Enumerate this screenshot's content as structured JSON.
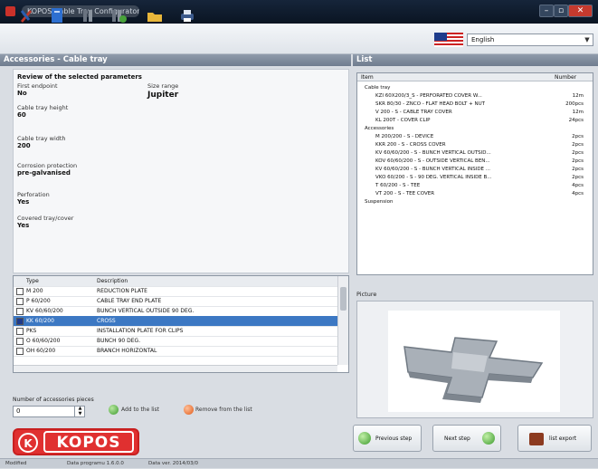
{
  "window": {
    "title": "KOPOS Cable Tray Configurator"
  },
  "toolbar": {
    "icons": [
      "tools-icon",
      "document-icon",
      "book-icon",
      "book-add-icon",
      "folder-icon",
      "print-icon"
    ],
    "language": "English"
  },
  "left_header": "Accessories - Cable tray",
  "right_header": "List",
  "params": {
    "section_title": "Review of the selected parameters",
    "first_label": "First endpoint",
    "first_value": "No",
    "range_label": "Size range",
    "range_value": "Jupiter",
    "height_label": "Cable tray height",
    "height_value": "60",
    "width_label": "Cable tray width",
    "width_value": "200",
    "corrosion_label": "Corrosion protection",
    "corrosion_value": "pre-galvanised",
    "perforation_label": "Perforation",
    "perforation_value": "Yes",
    "covered_label": "Covered tray/cover",
    "covered_value": "Yes"
  },
  "table": {
    "headers": [
      "Type",
      "Description"
    ],
    "rows": [
      {
        "type": "M 200",
        "desc": "REDUCTION PLATE",
        "selected": false
      },
      {
        "type": "P 60/200",
        "desc": "CABLE TRAY END PLATE",
        "selected": false
      },
      {
        "type": "KV 60/60/200",
        "desc": "BUNCH VERTICAL OUTSIDE 90 DEG.",
        "selected": false
      },
      {
        "type": "KK 60/200",
        "desc": "CROSS",
        "selected": true
      },
      {
        "type": "PKS",
        "desc": "INSTALLATION PLATE FOR CLIPS",
        "selected": false
      },
      {
        "type": "O 60/60/200",
        "desc": "BUNCH 90 DEG.",
        "selected": false
      },
      {
        "type": "OH 60/200",
        "desc": "BRANCH HORIZONTAL",
        "selected": false
      }
    ]
  },
  "qty": {
    "label": "Number of accessories pieces",
    "value": "0"
  },
  "buttons": {
    "add": "Add to the list",
    "remove": "Remove from the list",
    "previous": "Previous step",
    "next": "Next step",
    "export": "list export"
  },
  "logo": {
    "text": "KOPOS",
    "glyph": "K"
  },
  "list": {
    "headers": [
      "Item",
      "Number"
    ],
    "items": [
      {
        "text": "Cable tray",
        "qty": "",
        "level": 0
      },
      {
        "text": "KZI 60X200/3_S - PERFORATED COVER W...",
        "qty": "12m",
        "level": 1
      },
      {
        "text": "SKR 80/30 - ZNCO - FLAT HEAD BOLT + NUT",
        "qty": "200pcs",
        "level": 1
      },
      {
        "text": "V 200 - S - CABLE TRAY COVER",
        "qty": "12m",
        "level": 1
      },
      {
        "text": "KL 200T - COVER CLIP",
        "qty": "24pcs",
        "level": 1
      },
      {
        "text": "Accessories",
        "qty": "",
        "level": 0
      },
      {
        "text": "M 200/200 - S - DEVICE",
        "qty": "2pcs",
        "level": 1
      },
      {
        "text": "KKR 200 - S - CROSS COVER",
        "qty": "2pcs",
        "level": 1
      },
      {
        "text": "KV 60/60/200 - S - BUNCH VERTICAL OUTSID...",
        "qty": "2pcs",
        "level": 1
      },
      {
        "text": "KOV 60/60/200 - S - OUTSIDE VERTICAL BEN...",
        "qty": "2pcs",
        "level": 1
      },
      {
        "text": "KV 60/60/200 - S - BUNCH VERTICAL INSIDE ...",
        "qty": "2pcs",
        "level": 1
      },
      {
        "text": "VKO 60/200 - S - 90 DEG. VERTICAL INSIDE B...",
        "qty": "2pcs",
        "level": 1
      },
      {
        "text": "T 60/200 - S - TEE",
        "qty": "4pcs",
        "level": 1
      },
      {
        "text": "VT 200 - S - TEE COVER",
        "qty": "4pcs",
        "level": 1
      },
      {
        "text": "Suspension",
        "qty": "",
        "level": 0
      }
    ]
  },
  "image_label": "Picture",
  "status": {
    "a": "Modified",
    "b": "Data programu 1.6.0.0",
    "c": "Data ver. 2014/03/0"
  }
}
